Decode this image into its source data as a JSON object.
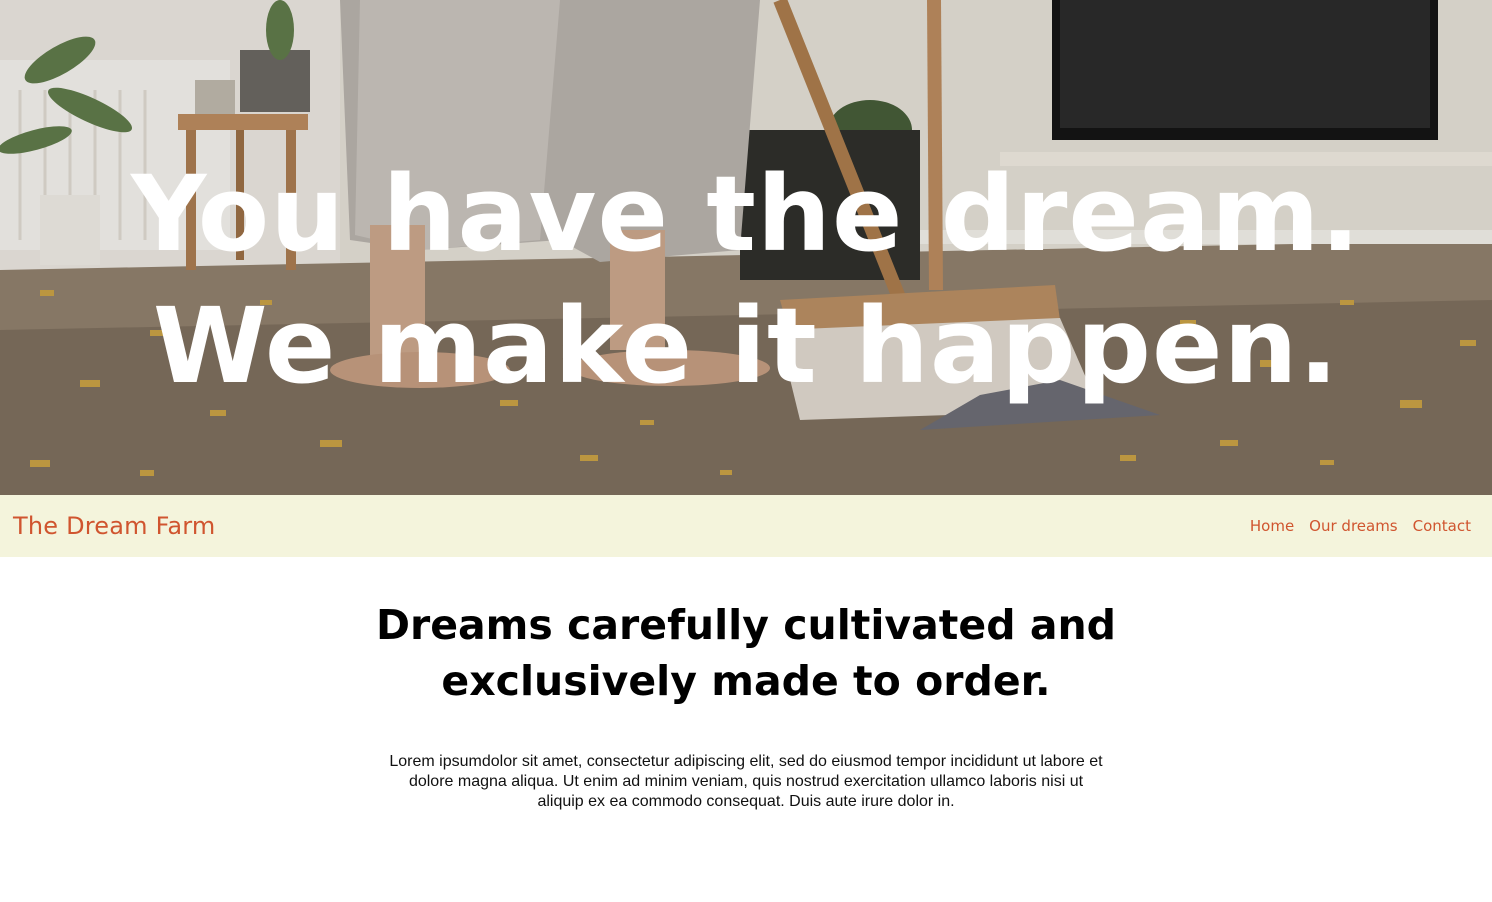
{
  "hero": {
    "line1": "You have the dream.",
    "line2": "We make it happen."
  },
  "nav": {
    "brand": "The Dream Farm",
    "links": [
      "Home",
      "Our dreams",
      "Contact"
    ]
  },
  "main": {
    "heading": "Dreams carefully cultivated and exclusively made to order.",
    "body": "Lorem ipsumdolor sit amet, consectetur adipiscing elit, sed do eiusmod tempor incididunt ut labore et dolore magna aliqua. Ut enim ad minim veniam, quis nostrud exercitation ullamco laboris nisi ut aliquip ex ea commodo consequat. Duis aute irure dolor in."
  },
  "colors": {
    "accent": "#d0552f",
    "nav_bg": "#f4f4dc",
    "text": "#000000"
  }
}
